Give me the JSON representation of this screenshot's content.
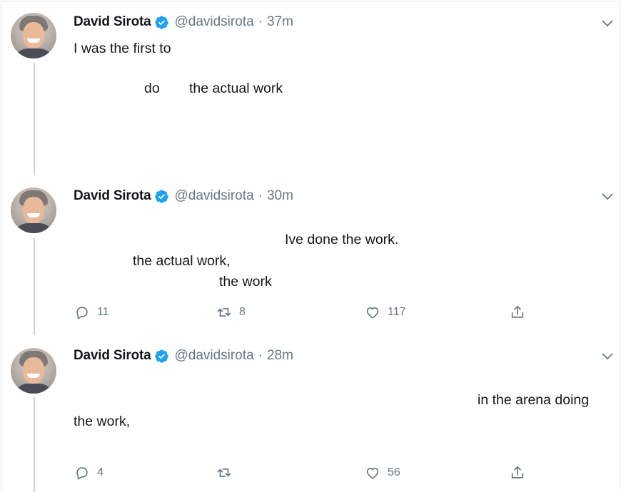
{
  "author": {
    "name": "David Sirota",
    "handle": "@davidsirota",
    "separator": "·"
  },
  "tweets": [
    {
      "time": "37m",
      "text_lines": [
        "I was the first to",
        "do",
        "the actual work"
      ]
    },
    {
      "time": "30m",
      "text_lines": [
        "Ive done the work.",
        "the actual work,",
        "the work"
      ],
      "replies": "11",
      "retweets": "8",
      "likes": "117"
    },
    {
      "time": "28m",
      "text_lines": [
        "in the arena doing",
        "the work,"
      ],
      "replies": "4",
      "retweets": "",
      "likes": "56"
    }
  ],
  "colors": {
    "text": "#14171a",
    "muted": "#657786",
    "verified": "#1da1f2",
    "thread_line": "#ccd6dd"
  },
  "icons": [
    "verified-badge-icon",
    "chevron-down-icon",
    "reply-icon",
    "retweet-icon",
    "like-icon",
    "share-icon"
  ]
}
